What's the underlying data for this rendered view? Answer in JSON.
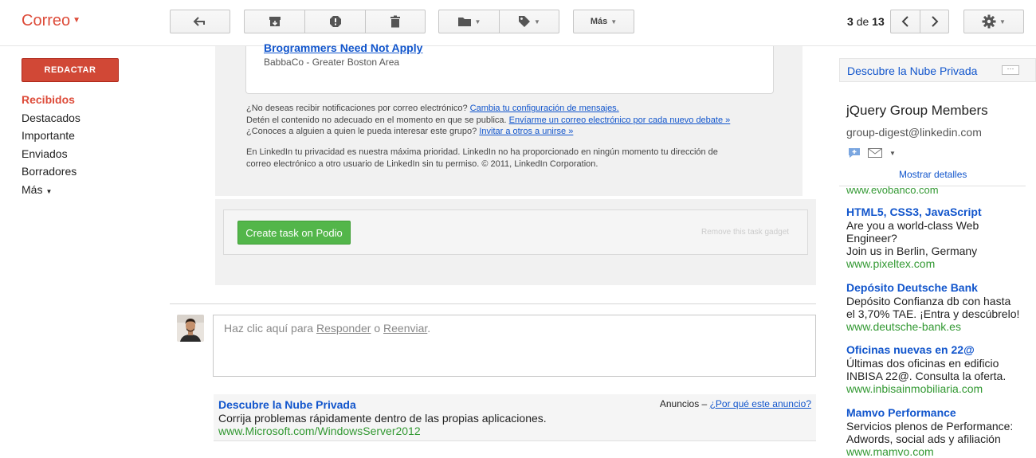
{
  "header": {
    "brand": "Correo",
    "more_label": "Más",
    "pager_current": "3",
    "pager_sep": "de",
    "pager_total": "13"
  },
  "nav": {
    "compose_label": "REDACTAR",
    "items": [
      {
        "label": "Recibidos"
      },
      {
        "label": "Destacados"
      },
      {
        "label": "Importante"
      },
      {
        "label": "Enviados"
      },
      {
        "label": "Borradores"
      },
      {
        "label": "Más"
      }
    ]
  },
  "message": {
    "job_title": "Brogrammers Need Not Apply",
    "job_company": "BabbaCo - Greater Boston Area",
    "notif_q": "¿No deseas recibir notificaciones por correo electrónico?",
    "notif_link": "Cambia tu configuración de mensajes.",
    "stop_text": "Detén el contenido no adecuado en el momento en que se publica.",
    "stop_link": "Envíarme un correo electrónico por cada nuevo debate »",
    "invite_q": "¿Conoces a alguien a quien le pueda interesar este grupo?",
    "invite_link": "Invitar a otros a unirse »",
    "privacy_1": "En LinkedIn tu privacidad es nuestra máxima prioridad. LinkedIn no ha proporcionado en ningún momento tu dirección de",
    "privacy_2": "correo electrónico a otro usuario de LinkedIn sin tu permiso. © 2011, LinkedIn Corporation."
  },
  "gadget": {
    "button_label": "Create task on Podio",
    "remove_label": "Remove this task gadget"
  },
  "reply": {
    "prefix": "Haz clic aquí para",
    "reply_link": "Responder",
    "or": "o",
    "forward_link": "Reenviar",
    "suffix": "."
  },
  "bottom_ad": {
    "title": "Descubre la Nube Privada",
    "desc": "Corrija problemas rápidamente dentro de las propias aplicaciones.",
    "url": "www.Microsoft.com/WindowsServer2012",
    "label": "Anuncios –",
    "why_link": "¿Por qué este anuncio?"
  },
  "sidebar": {
    "top_title": "Descubre la Nube Privada",
    "person_name": "jQuery Group Members",
    "person_email": "group-digest@linkedin.com",
    "show_details": "Mostrar detalles",
    "cut_url": "www.evobanco.com",
    "ads": [
      {
        "title": "HTML5, CSS3, JavaScript",
        "desc": [
          "Are you a world-class Web",
          "Engineer?",
          "Join us in Berlin, Germany"
        ],
        "url": "www.pixeltex.com"
      },
      {
        "title": "Depósito Deutsche Bank",
        "desc": [
          "Depósito Confianza db con hasta",
          "el 3,70% TAE. ¡Entra y descúbrelo!"
        ],
        "url": "www.deutsche-bank.es"
      },
      {
        "title": "Oficinas nuevas en 22@",
        "desc": [
          "Últimas dos oficinas en edificio",
          "INBISA 22@. Consulta la oferta."
        ],
        "url": "www.inbisainmobiliaria.com"
      },
      {
        "title": "Mamvo Performance",
        "desc": [
          "Servicios plenos de Performance:",
          "Adwords, social ads y afiliación"
        ],
        "url": "www.mamvo.com"
      }
    ]
  },
  "colors": {
    "brand": "#dd4b39",
    "compose": "#d14836",
    "link": "#1155cc",
    "ad_url": "#339933",
    "podio": "#53b64a"
  }
}
